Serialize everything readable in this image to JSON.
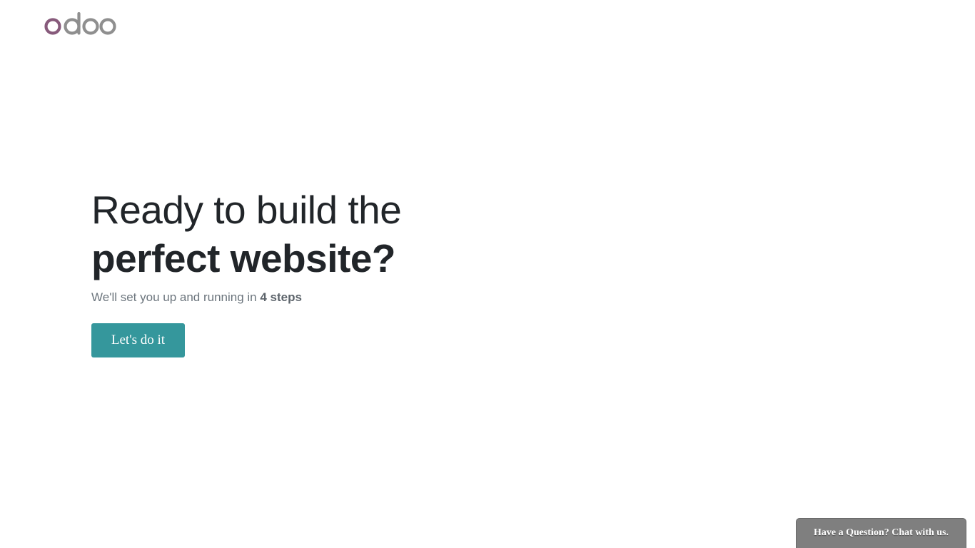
{
  "brand": {
    "logo_text": "odoo",
    "logo_icon": "odoo-logo",
    "colors": {
      "first_o": "#875a7b",
      "rest": "#8f8f8f"
    }
  },
  "hero": {
    "headline_line1": "Ready to build the",
    "headline_line2": "perfect website?",
    "subtitle_prefix": "We'll set you up and running in ",
    "subtitle_highlight": "4 steps"
  },
  "cta": {
    "label": "Let's do it",
    "color": "#35979c"
  },
  "chat": {
    "label": "Have a Question? Chat with us.",
    "color": "#7f7f7f"
  }
}
